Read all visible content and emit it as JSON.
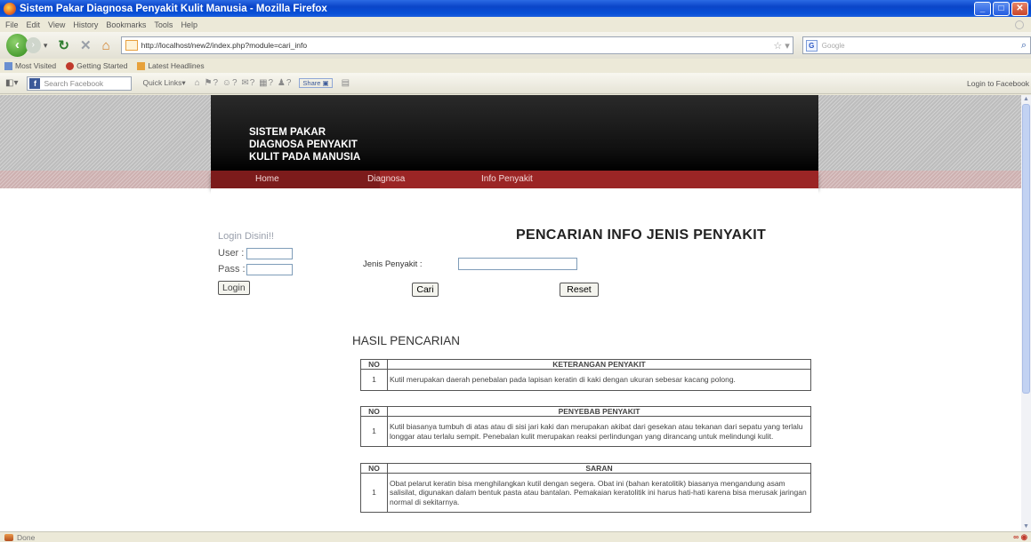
{
  "window": {
    "title": "Sistem Pakar Diagnosa Penyakit Kulit Manusia - Mozilla Firefox"
  },
  "menu": [
    "File",
    "Edit",
    "View",
    "History",
    "Bookmarks",
    "Tools",
    "Help"
  ],
  "navbar": {
    "url": "http://localhost/new2/index.php?module=cari_info",
    "search_placeholder": "Google"
  },
  "bookmarks": [
    "Most Visited",
    "Getting Started",
    "Latest Headlines"
  ],
  "facebook_bar": {
    "search_placeholder": "Search Facebook",
    "quick_links": "Quick Links",
    "share": "Share",
    "login": "Login to Facebook"
  },
  "site": {
    "logo_lines": [
      "SISTEM PAKAR",
      "DIAGNOSA PENYAKIT",
      "KULIT PADA MANUSIA"
    ],
    "nav": [
      "Home",
      "Diagnosa",
      "Info Penyakit"
    ]
  },
  "login": {
    "title": "Login Disini!!",
    "user_label": "User",
    "pass_label": "Pass",
    "colon": ":",
    "button": "Login"
  },
  "search": {
    "heading": "PENCARIAN INFO JENIS PENYAKIT",
    "label": "Jenis Penyakit :",
    "value": "",
    "cari": "Cari",
    "reset": "Reset"
  },
  "results": {
    "heading": "HASIL PENCARIAN",
    "tables": [
      {
        "col_no": "NO",
        "col_title": "KETERANGAN PENYAKIT",
        "no": "1",
        "text": "Kutil merupakan daerah penebalan pada lapisan keratin di kaki dengan ukuran sebesar kacang polong."
      },
      {
        "col_no": "NO",
        "col_title": "PENYEBAB PENYAKIT",
        "no": "1",
        "text": "Kutil biasanya tumbuh di atas atau di sisi jari kaki dan merupakan akibat dari gesekan atau tekanan dari sepatu yang terlalu longgar atau terlalu sempit. Penebalan kulit merupakan reaksi perlindungan yang dirancang untuk melindungi kulit."
      },
      {
        "col_no": "NO",
        "col_title": "SARAN",
        "no": "1",
        "text": "Obat pelarut keratin bisa menghilangkan kutil dengan segera. Obat ini (bahan keratolitik) biasanya mengandung asam salisilat, digunakan dalam bentuk pasta atau bantalan. Pemakaian keratolitik ini harus hati-hati karena bisa merusak jaringan normal di sekitarnya."
      }
    ]
  },
  "status": {
    "text": "Done"
  }
}
